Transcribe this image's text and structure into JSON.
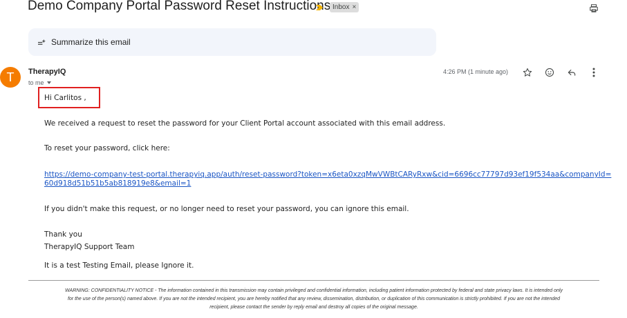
{
  "email": {
    "subject": "Demo Company Portal Password Reset Instructions",
    "label": "Inbox",
    "label_remove": "×",
    "summarize_label": "Summarize this email",
    "sender": {
      "name": "TherapyIQ",
      "avatar_letter": "T",
      "avatar_color": "#f57c00",
      "recipient": "to me",
      "timestamp": "4:26 PM (1 minute ago)"
    },
    "body": {
      "greeting": "Hi Carlitos ,",
      "line1": "We received a request to reset the password for your Client Portal account associated with this email address.",
      "line2": "To reset your password, click here:",
      "link_line1": "https://demo-company-test-portal.therapyiq.app/auth/reset-password?token=x6eta0xzqMwVWBtCARyRxw&cid=6696cc77797d93ef19f534aa&companyId=",
      "link_line2": "60d918d51b51b5ab818919e8&email=1",
      "line3": "If you didn't make this request, or no longer need to reset your password, you can ignore this email.",
      "closing": "Thank you",
      "signature": "TherapyIQ Support Team",
      "note": "It is a test Testing Email, please Ignore it."
    },
    "disclaimer": {
      "line1": "WARNING: CONFIDENTIALITY NOTICE - The information contained in this transmission may contain privileged and confidential information, including patient information protected by federal and state privacy laws. It is intended only",
      "line2": "for the use of the person(s) named above. If you are not the intended recipient, you are hereby notified that any review, dissemination, distribution, or duplication of this communication is strictly prohibited. If you are not the intended",
      "line3": "recipient, please contact the sender by reply email and destroy all copies of the original message."
    }
  },
  "icons": {
    "print": "print-icon",
    "importance": "importance-marker-icon",
    "summarize": "sparkle-icon",
    "star": "star-icon",
    "emoji": "emoji-icon",
    "reply": "reply-icon",
    "more": "more-vertical-icon",
    "dropdown": "chevron-down-icon"
  },
  "colors": {
    "accent_link": "#1a55c4",
    "highlight_box": "#e02020",
    "importance": "#f4b400"
  }
}
